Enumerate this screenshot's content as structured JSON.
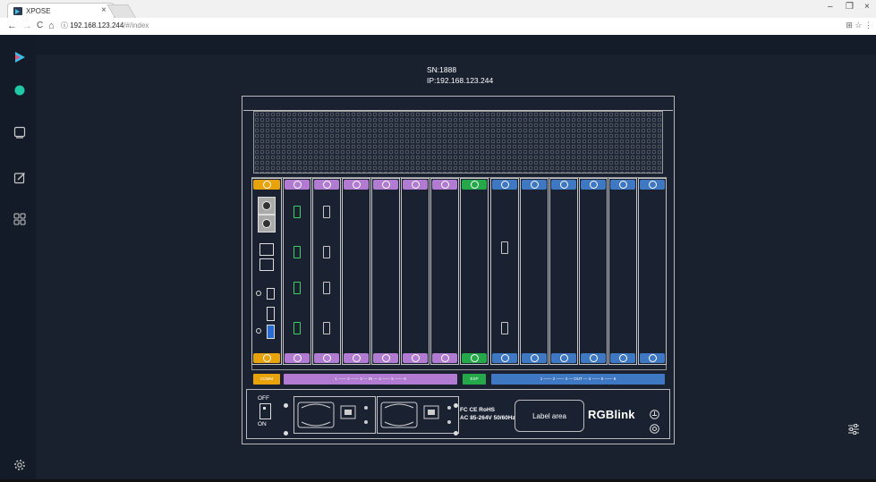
{
  "browser": {
    "tab_title": "XPOSE",
    "tab_close": "×",
    "url_host": "192.168.123.244",
    "url_path": "/#/index",
    "window_min": "–",
    "window_max": "❐",
    "window_close": "×",
    "nav_back": "←",
    "nav_forward": "→",
    "nav_reload": "C",
    "nav_home": "⌂",
    "info_icon": "ⓘ",
    "addr_icons": "⊞ ☆ ⋮"
  },
  "sidebar": {
    "items": [
      {
        "icon": "xpose-logo-icon"
      },
      {
        "icon": "status-dot-icon"
      },
      {
        "icon": "screen-icon"
      },
      {
        "icon": "edit-icon"
      },
      {
        "icon": "grid-icon"
      },
      {
        "icon": "settings-gear-icon"
      }
    ]
  },
  "device": {
    "sn": "SN:1888",
    "ip": "IP:192.168.123.244",
    "label_area": "Label area",
    "brand": "RGBlink",
    "cert_line1": "FC CE RoHS",
    "cert_line2": "AC 85-264V 50/60Hz",
    "switch_off": "OFF",
    "switch_on": "ON",
    "strip_comm": "COMM",
    "strip_in": "1 —— 2 —— 3 — IN — 4 —— 5 —— 6",
    "strip_exp": "EXP",
    "strip_out": "1 —— 2 —— 3 — OUT — 4 —— 5 —— 6",
    "colors": {
      "comm": "#e8a20a",
      "input": "#b07bd0",
      "exp": "#24a84a",
      "output": "#3f78c2"
    }
  },
  "controls": {
    "filter_icon": "filter-sliders-icon"
  }
}
